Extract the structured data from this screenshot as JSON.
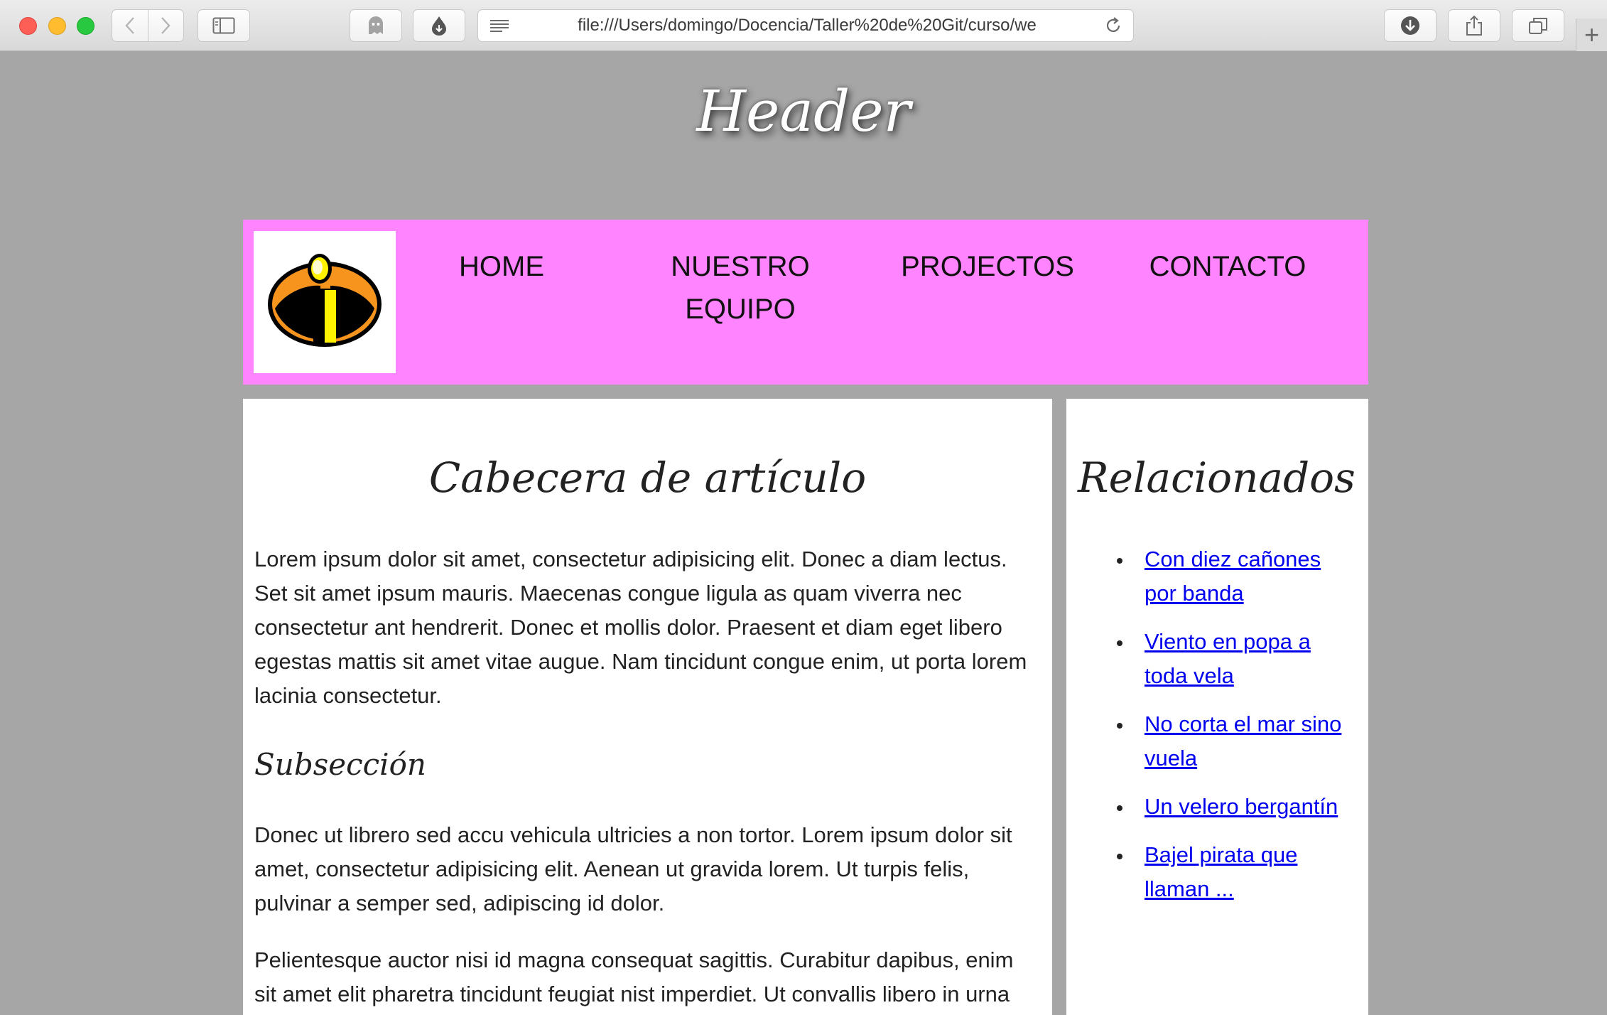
{
  "browser": {
    "url": "file:///Users/domingo/Docencia/Taller%20de%20Git/curso/we",
    "new_tab_symbol": "+"
  },
  "page": {
    "header": "Header",
    "nav": {
      "logo_icon": "incredibles-logo-icon",
      "items": [
        {
          "label": "HOME"
        },
        {
          "label": "NUESTRO\nEQUIPO"
        },
        {
          "label": "PROJECTOS"
        },
        {
          "label": "CONTACTO"
        }
      ]
    },
    "article": {
      "title": "Cabecera de artículo",
      "paragraph1": "Lorem ipsum dolor sit amet, consectetur adipisicing elit. Donec a diam lectus. Set sit amet ipsum mauris. Maecenas congue ligula as quam viverra nec consectetur ant hendrerit. Donec et mollis dolor. Praesent et diam eget libero egestas mattis sit amet vitae augue. Nam tincidunt congue enim, ut porta lorem lacinia consectetur.",
      "subheading": "Subsección",
      "paragraph2": "Donec ut librero sed accu vehicula ultricies a non tortor. Lorem ipsum dolor sit amet, consectetur adipisicing elit. Aenean ut gravida lorem. Ut turpis felis, pulvinar a semper sed, adipiscing id dolor.",
      "paragraph3": "Pelientesque auctor nisi id magna consequat sagittis. Curabitur dapibus, enim sit amet elit pharetra tincidunt feugiat nist imperdiet. Ut convallis libero in urna"
    },
    "aside": {
      "title": "Relacionados",
      "links": [
        {
          "label": "Con diez cañones por banda"
        },
        {
          "label": "Viento en popa a toda vela"
        },
        {
          "label": "No corta el mar sino vuela"
        },
        {
          "label": "Un velero bergantín"
        },
        {
          "label": "Bajel pirata que llaman ..."
        }
      ]
    }
  },
  "colors": {
    "page_background": "#a6a6a6",
    "nav_background": "#ff84ff",
    "link": "#0000ee",
    "logo_orange": "#f7941d",
    "logo_yellow": "#fff200"
  }
}
